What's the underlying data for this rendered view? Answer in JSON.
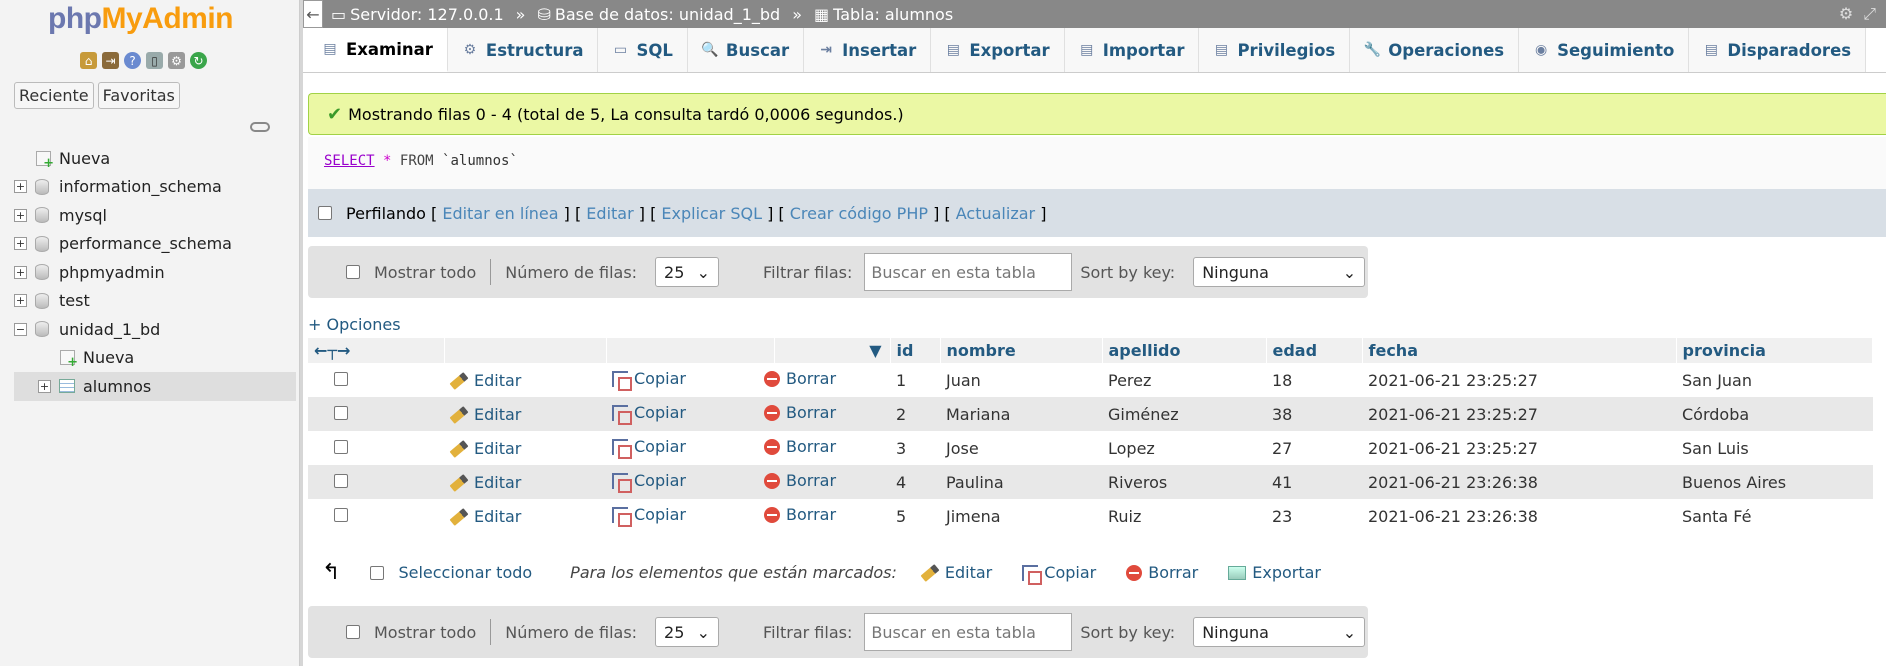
{
  "sidebar": {
    "logo_php": "php",
    "logo_admin": "MyAdmin",
    "tabs": [
      "Reciente",
      "Favoritas"
    ],
    "tree": [
      {
        "label": "Nueva",
        "type": "new",
        "indent": 0
      },
      {
        "label": "information_schema",
        "type": "db",
        "indent": 0,
        "toggle": "+"
      },
      {
        "label": "mysql",
        "type": "db",
        "indent": 0,
        "toggle": "+"
      },
      {
        "label": "performance_schema",
        "type": "db",
        "indent": 0,
        "toggle": "+"
      },
      {
        "label": "phpmyadmin",
        "type": "db",
        "indent": 0,
        "toggle": "+"
      },
      {
        "label": "test",
        "type": "db",
        "indent": 0,
        "toggle": "+"
      },
      {
        "label": "unidad_1_bd",
        "type": "db",
        "indent": 0,
        "toggle": "−"
      },
      {
        "label": "Nueva",
        "type": "new",
        "indent": 1
      },
      {
        "label": "alumnos",
        "type": "table",
        "indent": 1,
        "toggle": "+",
        "active": true
      }
    ]
  },
  "topbar": {
    "server": "Servidor: 127.0.0.1",
    "database": "Base de datos: unidad_1_bd",
    "table": "Tabla: alumnos",
    "separator": "»"
  },
  "tabs": [
    "Examinar",
    "Estructura",
    "SQL",
    "Buscar",
    "Insertar",
    "Exportar",
    "Importar",
    "Privilegios",
    "Operaciones",
    "Seguimiento",
    "Disparadores"
  ],
  "tab_icons": [
    "▤",
    "⚙",
    "▭",
    "🔍",
    "⇥",
    "▤",
    "▤",
    "▤",
    "🔧",
    "◉",
    "▤"
  ],
  "message": "Mostrando filas 0 - 4 (total de 5, La consulta tardó 0,0006 segundos.)",
  "sql": {
    "select": "SELECT",
    "star": "*",
    "from": "FROM",
    "table": "`alumnos`"
  },
  "profile": {
    "label": "Perfilando",
    "links": [
      "Editar en línea",
      "Editar",
      "Explicar SQL",
      "Crear código PHP",
      "Actualizar"
    ]
  },
  "nav": {
    "show_all": "Mostrar todo",
    "rows_label": "Número de filas:",
    "rows_value": "25",
    "filter_label": "Filtrar filas:",
    "filter_placeholder": "Buscar en esta tabla",
    "sort_label": "Sort by key:",
    "sort_value": "Ninguna"
  },
  "options_link": "+ Opciones",
  "columns": [
    "id",
    "nombre",
    "apellido",
    "edad",
    "fecha",
    "provincia"
  ],
  "row_actions": {
    "edit": "Editar",
    "copy": "Copiar",
    "delete": "Borrar"
  },
  "rows": [
    [
      "1",
      "Juan",
      "Perez",
      "18",
      "2021-06-21 23:25:27",
      "San Juan"
    ],
    [
      "2",
      "Mariana",
      "Giménez",
      "38",
      "2021-06-21 23:25:27",
      "Córdoba"
    ],
    [
      "3",
      "Jose",
      "Lopez",
      "27",
      "2021-06-21 23:25:27",
      "San Luis"
    ],
    [
      "4",
      "Paulina",
      "Riveros",
      "41",
      "2021-06-21 23:26:38",
      "Buenos Aires"
    ],
    [
      "5",
      "Jimena",
      "Ruiz",
      "23",
      "2021-06-21 23:26:38",
      "Santa Fé"
    ]
  ],
  "bottom": {
    "select_all": "Seleccionar todo",
    "marked_label": "Para los elementos que están marcados:",
    "edit": "Editar",
    "copy": "Copiar",
    "delete": "Borrar",
    "export": "Exportar"
  }
}
